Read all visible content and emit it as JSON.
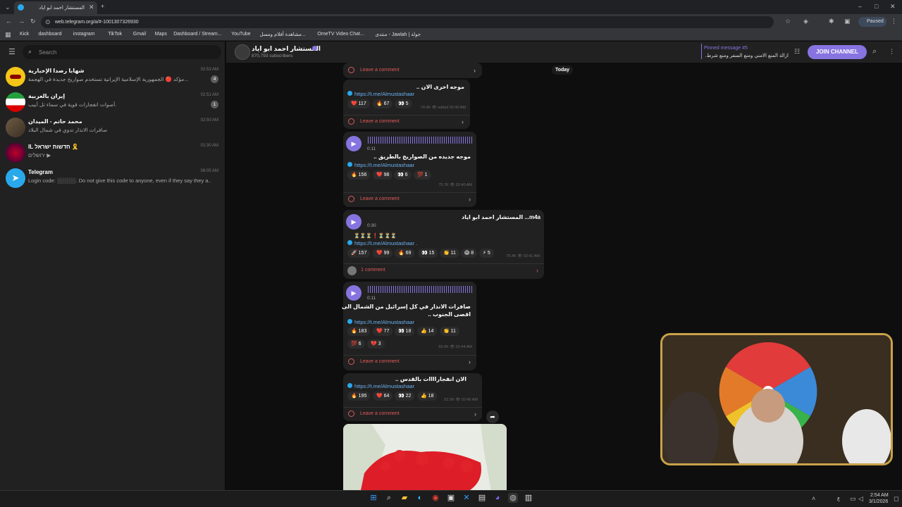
{
  "browser": {
    "tab_title": "المستشار احمد ابو اياد",
    "url": "web.telegram.org/a/#-1001307326930",
    "status_badge": "Paused",
    "bookmarks": [
      "Kick",
      "dashboard",
      "instagram",
      "TikTok",
      "Gmail",
      "Maps",
      "Dashboard / Stream...",
      "YouTube",
      "مشاهدة أفلام ومسل...",
      "OmeTV Video Chat...",
      "منتدى - Jawlah | جولة"
    ]
  },
  "sidebar": {
    "search_placeholder": "Search",
    "chats": [
      {
        "name": "شهابا رصدا الإخبارية",
        "preview": "مؤكد 🔴 الجمهورية الإسلامية الإيرانية تستخدم صواريخ جديدة في الهجمة...",
        "time": "02:53 AM",
        "badge": "4"
      },
      {
        "name": "إيران بالعربية",
        "preview": "أصوات انفجارات قوية في سماء تل أبيب.",
        "time": "02:51 AM",
        "badge": "1"
      },
      {
        "name": "محمد حاتم - الميدان",
        "preview": "صافرات الانذار تدوي في شمال البلاد",
        "time": "02:50 AM",
        "badge": ""
      },
      {
        "name": "IL חדשות ישראל 🎗️",
        "preview": "ירושלים ▶",
        "time": "02:30 AM",
        "badge": ""
      },
      {
        "name": "Telegram",
        "preview": "Login code: ░░░░░. Do not give this code to anyone, even if they say they a...",
        "time": "08:05 AM",
        "badge": ""
      }
    ]
  },
  "channel": {
    "name": "المستشار احمد ابو اياد",
    "subscribers": "870,793 subscribers",
    "pinned_label": "Pinned message #5",
    "pinned_text": "ازالة المنع الامني ومنع السفر ومنع شرط...",
    "join_label": "JOIN CHANNEL",
    "date_chip": "Today"
  },
  "messages": {
    "top_comment": "Leave a comment",
    "m1": {
      "text": "موجه اخرى الان ..",
      "link": "https://t.me/Almustashaar",
      "reactions": [
        "❤️ 117",
        "🔥 67",
        "👀 5"
      ],
      "meta": "74.4K 👁 edited 02:40 AM",
      "comment": "Leave a comment"
    },
    "m2": {
      "duration": "0:11",
      "text": "موجه جديده من الصواريخ بالطريق ..",
      "link": "https://t.me/Almustashaar",
      "reactions": [
        "🔥 156",
        "❤️ 98",
        "👀 6",
        "💯 1"
      ],
      "meta": "75.7K 👁 02:40 AM",
      "comment": "Leave a comment"
    },
    "m3": {
      "file": "m4a... المستشار احمد ابو اياد",
      "duration": "0:30",
      "text": "⏳⏳⏳❗⏳⏳⏳",
      "link": "https://t.me/Almustashaar .",
      "reactions": [
        "🚀 157",
        "❤️ 99",
        "🔥 69",
        "👀 15",
        "👏 11",
        "😱 8",
        "⚡ 5"
      ],
      "meta": "75.4K 👁 02:41 AM",
      "comment": "1 comment"
    },
    "m4": {
      "duration": "0:11",
      "text1": "صافرات الانذار في كل إسرائيل من الشمال الى",
      "text2": "اقصى الجنوب ..",
      "link": "https://t.me/Almustashaar",
      "reactions": [
        "🔥 183",
        "❤️ 77",
        "👀 18",
        "👍 14",
        "👏 11",
        "💯 6",
        "💔 3"
      ],
      "meta": "69.6K 👁 02:44 AM",
      "comment": "Leave a comment"
    },
    "m5": {
      "text": "الان انفجاراااات بالقدس ..",
      "link": "https://t.me/Almustashaar",
      "reactions": [
        "🔥 195",
        "❤️ 64",
        "👀 22",
        "👍 18"
      ],
      "meta": "62.5K 👁 02:45 AM",
      "comment": "Leave a comment"
    }
  },
  "taskbar": {
    "time": "2:54 AM",
    "date": "3/1/2026",
    "lang": "ع"
  },
  "colors": {
    "accent": "#8774e1",
    "link": "#6ab3f3",
    "comment": "#e05a5a"
  }
}
